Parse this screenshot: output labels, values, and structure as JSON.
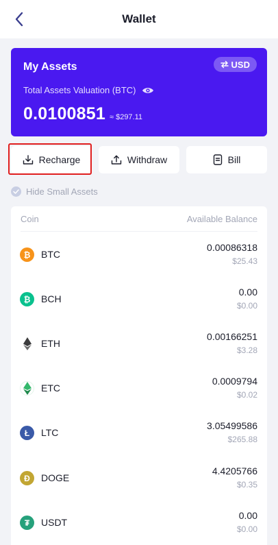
{
  "header": {
    "title": "Wallet",
    "back_icon": "chevron-left-icon"
  },
  "assets": {
    "title": "My Assets",
    "currency_toggle": "USD",
    "currency_toggle_icon": "swap-icon",
    "valuation_label": "Total Assets Valuation (BTC)",
    "valuation_value": "0.0100851",
    "valuation_fiat": "≈ $297.11",
    "background_color": "#4a19f0"
  },
  "actions": {
    "recharge": "Recharge",
    "withdraw": "Withdraw",
    "bill": "Bill"
  },
  "filter": {
    "hide_small_assets": "Hide Small Assets"
  },
  "table": {
    "col_coin": "Coin",
    "col_balance": "Available Balance",
    "rows": [
      {
        "symbol": "BTC",
        "balance": "0.00086318",
        "fiat": "$25.43",
        "icon": "bitcoin-icon",
        "color": "#f7931a",
        "glyph": "₿"
      },
      {
        "symbol": "BCH",
        "balance": "0.00",
        "fiat": "$0.00",
        "icon": "bitcoin-cash-icon",
        "color": "#0ac18e",
        "glyph": "₿"
      },
      {
        "symbol": "ETH",
        "balance": "0.00166251",
        "fiat": "$3.28",
        "icon": "ethereum-icon",
        "color": "#3c3c3d",
        "glyph": ""
      },
      {
        "symbol": "ETC",
        "balance": "0.0009794",
        "fiat": "$0.02",
        "icon": "ethereum-classic-icon",
        "color": "#33b86b",
        "glyph": ""
      },
      {
        "symbol": "LTC",
        "balance": "3.05499586",
        "fiat": "$265.88",
        "icon": "litecoin-icon",
        "color": "#3a5aa8",
        "glyph": "Ł"
      },
      {
        "symbol": "DOGE",
        "balance": "4.4205766",
        "fiat": "$0.35",
        "icon": "dogecoin-icon",
        "color": "#c2a633",
        "glyph": "Ð"
      },
      {
        "symbol": "USDT",
        "balance": "0.00",
        "fiat": "$0.00",
        "icon": "tether-icon",
        "color": "#26a17b",
        "glyph": "₮"
      }
    ]
  }
}
